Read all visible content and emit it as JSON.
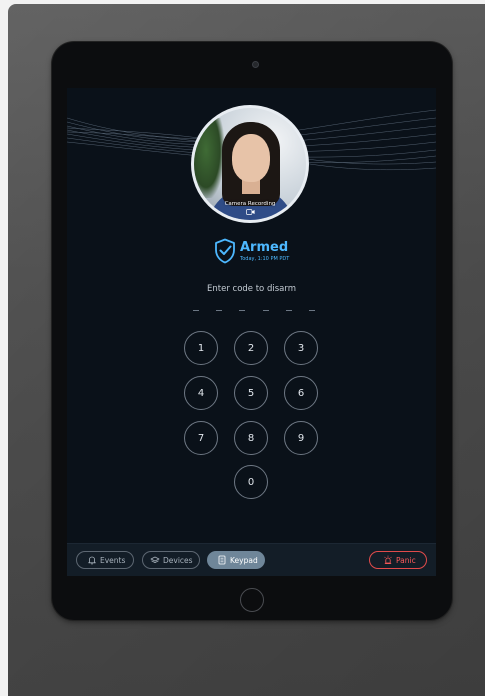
{
  "camera": {
    "label": "Camera Recording",
    "icon": "video-camera-icon"
  },
  "status": {
    "label": "Armed",
    "time": "Today, 1:10 PM PDT",
    "color": "#4db8ff",
    "icon": "shield-check-icon"
  },
  "keypad": {
    "prompt": "Enter code to disarm",
    "code_length": 6,
    "entered_digits": 0,
    "keys": [
      "1",
      "2",
      "3",
      "4",
      "5",
      "6",
      "7",
      "8",
      "9",
      "0"
    ]
  },
  "nav": {
    "events_label": "Events",
    "devices_label": "Devices",
    "keypad_label": "Keypad",
    "panic_label": "Panic",
    "active": "Keypad",
    "panic_color": "#e14b4b"
  }
}
